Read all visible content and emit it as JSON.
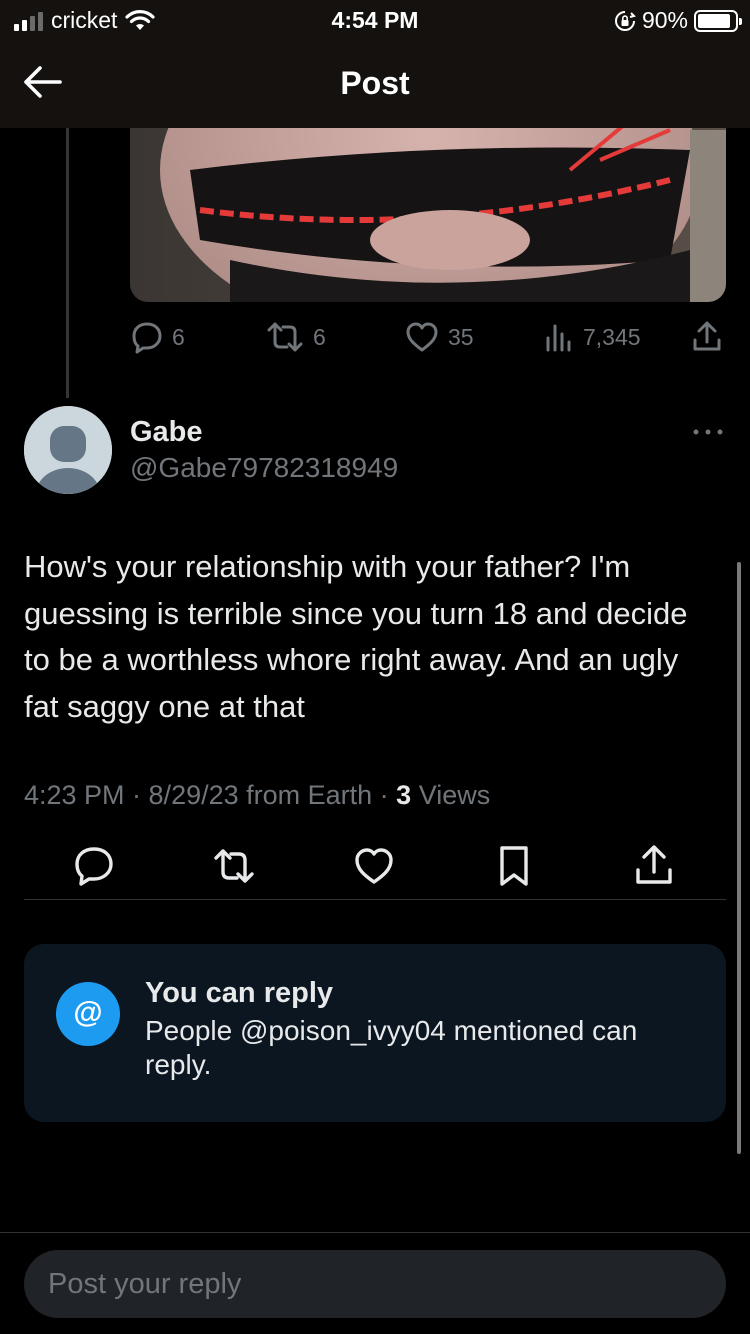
{
  "status_bar": {
    "carrier": "cricket",
    "time": "4:54 PM",
    "battery": "90%"
  },
  "header": {
    "title": "Post"
  },
  "parent_post": {
    "replies": "6",
    "reposts": "6",
    "likes": "35",
    "views": "7,345"
  },
  "reply": {
    "name": "Gabe",
    "handle": "@Gabe79782318949",
    "text": "How's your relationship with your father? I'm guessing is terrible since you turn 18 and decide to be a worthless whore right away. And an ugly fat saggy one at that",
    "time": "4:23 PM · 8/29/23 from Earth · ",
    "views_count": "3",
    "views_label": " Views"
  },
  "reply_restriction": {
    "icon_text": "@",
    "title": "You can reply",
    "text": "People @poison_ivyy04 mentioned can reply."
  },
  "composer": {
    "placeholder": "Post your reply"
  },
  "colors": {
    "accent": "#1d9bf0",
    "background": "#000000",
    "muted": "#71767b",
    "card": "#0c1621"
  }
}
